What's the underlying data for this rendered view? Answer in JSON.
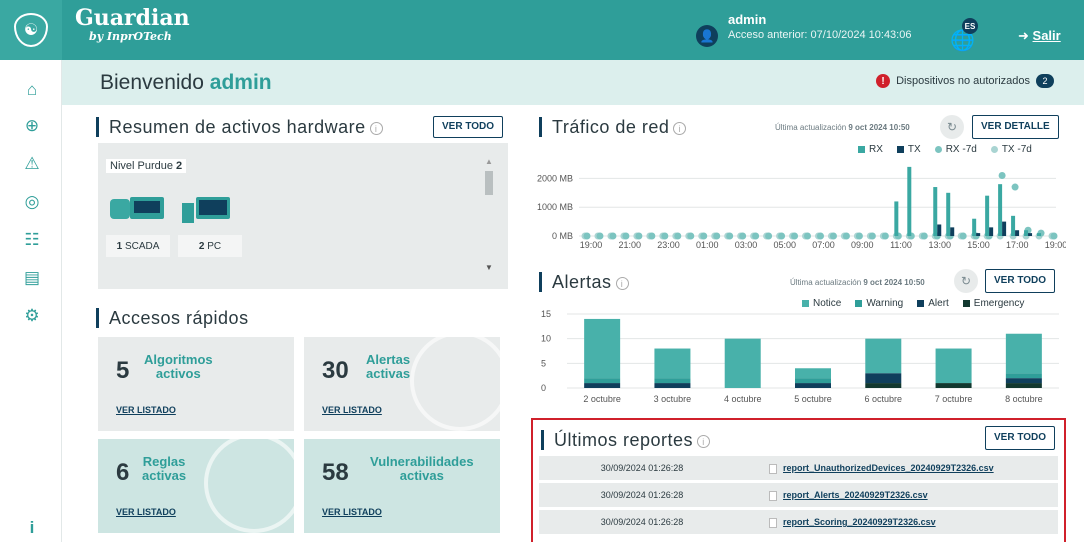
{
  "app": {
    "name": "Guardian",
    "subtitle": "by InprOTech"
  },
  "user": {
    "name": "admin",
    "last_access": "Acceso anterior: 07/10/2024 10:43:06",
    "lang": "ES",
    "logout": "Salir"
  },
  "welcome": {
    "prefix": "Bienvenido",
    "user": "admin",
    "unauth_label": "Dispositivos no autorizados",
    "unauth_count": "2"
  },
  "sidebar": {
    "items": [
      "home-icon",
      "network-icon",
      "warning-icon",
      "fingerprint-icon",
      "topology-icon",
      "document-icon",
      "settings-icon"
    ],
    "info": "i"
  },
  "hardware": {
    "title": "Resumen de activos hardware",
    "button": "VER TODO",
    "purdue_label": "Nivel Purdue",
    "purdue_level": "2",
    "items": [
      {
        "count": "1",
        "label": "SCADA"
      },
      {
        "count": "2",
        "label": "PC"
      }
    ]
  },
  "quick": {
    "title": "Accesos rápidos",
    "link_label": "VER LISTADO",
    "cards": [
      {
        "num": "5",
        "label1": "Algoritmos",
        "label2": "activos"
      },
      {
        "num": "30",
        "label1": "Alertas",
        "label2": "activas"
      },
      {
        "num": "6",
        "label1": "Reglas",
        "label2": "activas"
      },
      {
        "num": "58",
        "label1": "Vulnerabilidades",
        "label2": "activas"
      }
    ]
  },
  "traffic": {
    "title": "Tráfico de red",
    "updated_prefix": "Última actualización",
    "updated": "9 oct 2024 10:50",
    "button": "VER DETALLE",
    "legend": [
      "RX",
      "TX",
      "RX -7d",
      "TX -7d"
    ],
    "colors": {
      "rx": "#3aa8a2",
      "tx": "#0f3f5c",
      "rx7": "#7cc4c0",
      "tx7": "#a9d4d2"
    }
  },
  "alerts": {
    "title": "Alertas",
    "updated_prefix": "Última actualización",
    "updated": "9 oct 2024 10:50",
    "button": "VER TODO",
    "legend": [
      "Notice",
      "Warning",
      "Alert",
      "Emergency"
    ]
  },
  "chart_data": [
    {
      "type": "bar",
      "title": "Tráfico de red",
      "ylabel": "",
      "yticks": [
        "0 MB",
        "1000 MB",
        "2000 MB"
      ],
      "ylim": [
        0,
        2500
      ],
      "x_ticks": [
        "19:00",
        "21:00",
        "23:00",
        "01:00",
        "03:00",
        "05:00",
        "07:00",
        "09:00",
        "11:00",
        "13:00",
        "15:00",
        "17:00",
        "19:00"
      ],
      "series": [
        {
          "name": "RX",
          "values": [
            0,
            0,
            0,
            0,
            0,
            0,
            0,
            0,
            0,
            0,
            0,
            0,
            0,
            0,
            0,
            0,
            0,
            0,
            0,
            0,
            0,
            0,
            0,
            0,
            1200,
            2400,
            0,
            1700,
            1500,
            0,
            600,
            1400,
            1800,
            700,
            200,
            100,
            0
          ]
        },
        {
          "name": "TX",
          "values": [
            0,
            0,
            0,
            0,
            0,
            0,
            0,
            0,
            0,
            0,
            0,
            0,
            0,
            0,
            0,
            0,
            0,
            0,
            0,
            0,
            0,
            0,
            0,
            0,
            0,
            0,
            0,
            400,
            300,
            0,
            100,
            300,
            500,
            200,
            100,
            0,
            0
          ]
        },
        {
          "name": "RX -7d",
          "values": [
            0,
            0,
            0,
            0,
            0,
            0,
            0,
            0,
            0,
            0,
            0,
            0,
            0,
            0,
            0,
            0,
            0,
            0,
            0,
            0,
            0,
            0,
            0,
            0,
            0,
            0,
            0,
            0,
            0,
            0,
            0,
            0,
            2100,
            1700,
            200,
            100,
            0
          ]
        },
        {
          "name": "TX -7d",
          "values": [
            0,
            0,
            0,
            0,
            0,
            0,
            0,
            0,
            0,
            0,
            0,
            0,
            0,
            0,
            0,
            0,
            0,
            0,
            0,
            0,
            0,
            0,
            0,
            0,
            0,
            0,
            0,
            0,
            0,
            0,
            0,
            0,
            0,
            0,
            0,
            0,
            0
          ]
        }
      ]
    },
    {
      "type": "bar",
      "title": "Alertas",
      "categories": [
        "2 octubre",
        "3 octubre",
        "4 octubre",
        "5 octubre",
        "6 octubre",
        "7 octubre",
        "8 octubre"
      ],
      "ylim": [
        0,
        15
      ],
      "yticks": [
        "0",
        "5",
        "10",
        "15"
      ],
      "series": [
        {
          "name": "Notice",
          "values": [
            12,
            6,
            10,
            2,
            7,
            7,
            8
          ]
        },
        {
          "name": "Warning",
          "values": [
            1,
            1,
            0,
            1,
            0,
            0,
            1
          ]
        },
        {
          "name": "Alert",
          "values": [
            1,
            1,
            0,
            1,
            2,
            0,
            1
          ]
        },
        {
          "name": "Emergency",
          "values": [
            0,
            0,
            0,
            0,
            1,
            1,
            1
          ]
        }
      ]
    }
  ],
  "reports": {
    "title": "Últimos reportes",
    "button": "VER TODO",
    "rows": [
      {
        "date": "30/09/2024 01:26:28",
        "file": "report_UnauthorizedDevices_20240929T2326.csv"
      },
      {
        "date": "30/09/2024 01:26:28",
        "file": "report_Alerts_20240929T2326.csv"
      },
      {
        "date": "30/09/2024 01:26:28",
        "file": "report_Scoring_20240929T2326.csv"
      }
    ]
  }
}
